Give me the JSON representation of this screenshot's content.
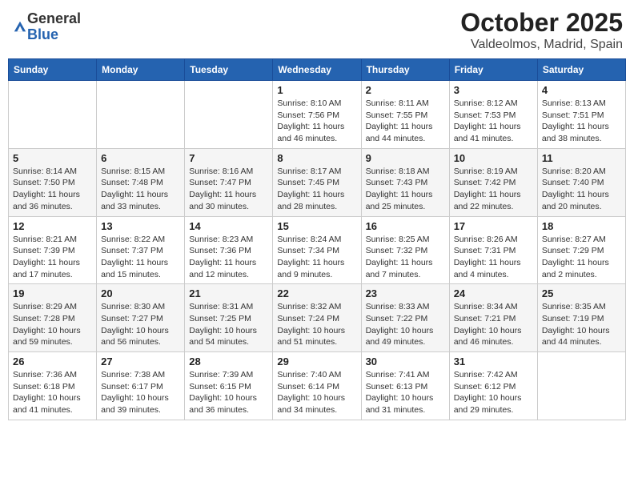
{
  "header": {
    "logo_general": "General",
    "logo_blue": "Blue",
    "title_month": "October 2025",
    "title_location": "Valdeolmos, Madrid, Spain"
  },
  "days_of_week": [
    "Sunday",
    "Monday",
    "Tuesday",
    "Wednesday",
    "Thursday",
    "Friday",
    "Saturday"
  ],
  "weeks": [
    [
      {
        "day": "",
        "sunrise": "",
        "sunset": "",
        "daylight": ""
      },
      {
        "day": "",
        "sunrise": "",
        "sunset": "",
        "daylight": ""
      },
      {
        "day": "",
        "sunrise": "",
        "sunset": "",
        "daylight": ""
      },
      {
        "day": "1",
        "sunrise": "Sunrise: 8:10 AM",
        "sunset": "Sunset: 7:56 PM",
        "daylight": "Daylight: 11 hours and 46 minutes."
      },
      {
        "day": "2",
        "sunrise": "Sunrise: 8:11 AM",
        "sunset": "Sunset: 7:55 PM",
        "daylight": "Daylight: 11 hours and 44 minutes."
      },
      {
        "day": "3",
        "sunrise": "Sunrise: 8:12 AM",
        "sunset": "Sunset: 7:53 PM",
        "daylight": "Daylight: 11 hours and 41 minutes."
      },
      {
        "day": "4",
        "sunrise": "Sunrise: 8:13 AM",
        "sunset": "Sunset: 7:51 PM",
        "daylight": "Daylight: 11 hours and 38 minutes."
      }
    ],
    [
      {
        "day": "5",
        "sunrise": "Sunrise: 8:14 AM",
        "sunset": "Sunset: 7:50 PM",
        "daylight": "Daylight: 11 hours and 36 minutes."
      },
      {
        "day": "6",
        "sunrise": "Sunrise: 8:15 AM",
        "sunset": "Sunset: 7:48 PM",
        "daylight": "Daylight: 11 hours and 33 minutes."
      },
      {
        "day": "7",
        "sunrise": "Sunrise: 8:16 AM",
        "sunset": "Sunset: 7:47 PM",
        "daylight": "Daylight: 11 hours and 30 minutes."
      },
      {
        "day": "8",
        "sunrise": "Sunrise: 8:17 AM",
        "sunset": "Sunset: 7:45 PM",
        "daylight": "Daylight: 11 hours and 28 minutes."
      },
      {
        "day": "9",
        "sunrise": "Sunrise: 8:18 AM",
        "sunset": "Sunset: 7:43 PM",
        "daylight": "Daylight: 11 hours and 25 minutes."
      },
      {
        "day": "10",
        "sunrise": "Sunrise: 8:19 AM",
        "sunset": "Sunset: 7:42 PM",
        "daylight": "Daylight: 11 hours and 22 minutes."
      },
      {
        "day": "11",
        "sunrise": "Sunrise: 8:20 AM",
        "sunset": "Sunset: 7:40 PM",
        "daylight": "Daylight: 11 hours and 20 minutes."
      }
    ],
    [
      {
        "day": "12",
        "sunrise": "Sunrise: 8:21 AM",
        "sunset": "Sunset: 7:39 PM",
        "daylight": "Daylight: 11 hours and 17 minutes."
      },
      {
        "day": "13",
        "sunrise": "Sunrise: 8:22 AM",
        "sunset": "Sunset: 7:37 PM",
        "daylight": "Daylight: 11 hours and 15 minutes."
      },
      {
        "day": "14",
        "sunrise": "Sunrise: 8:23 AM",
        "sunset": "Sunset: 7:36 PM",
        "daylight": "Daylight: 11 hours and 12 minutes."
      },
      {
        "day": "15",
        "sunrise": "Sunrise: 8:24 AM",
        "sunset": "Sunset: 7:34 PM",
        "daylight": "Daylight: 11 hours and 9 minutes."
      },
      {
        "day": "16",
        "sunrise": "Sunrise: 8:25 AM",
        "sunset": "Sunset: 7:32 PM",
        "daylight": "Daylight: 11 hours and 7 minutes."
      },
      {
        "day": "17",
        "sunrise": "Sunrise: 8:26 AM",
        "sunset": "Sunset: 7:31 PM",
        "daylight": "Daylight: 11 hours and 4 minutes."
      },
      {
        "day": "18",
        "sunrise": "Sunrise: 8:27 AM",
        "sunset": "Sunset: 7:29 PM",
        "daylight": "Daylight: 11 hours and 2 minutes."
      }
    ],
    [
      {
        "day": "19",
        "sunrise": "Sunrise: 8:29 AM",
        "sunset": "Sunset: 7:28 PM",
        "daylight": "Daylight: 10 hours and 59 minutes."
      },
      {
        "day": "20",
        "sunrise": "Sunrise: 8:30 AM",
        "sunset": "Sunset: 7:27 PM",
        "daylight": "Daylight: 10 hours and 56 minutes."
      },
      {
        "day": "21",
        "sunrise": "Sunrise: 8:31 AM",
        "sunset": "Sunset: 7:25 PM",
        "daylight": "Daylight: 10 hours and 54 minutes."
      },
      {
        "day": "22",
        "sunrise": "Sunrise: 8:32 AM",
        "sunset": "Sunset: 7:24 PM",
        "daylight": "Daylight: 10 hours and 51 minutes."
      },
      {
        "day": "23",
        "sunrise": "Sunrise: 8:33 AM",
        "sunset": "Sunset: 7:22 PM",
        "daylight": "Daylight: 10 hours and 49 minutes."
      },
      {
        "day": "24",
        "sunrise": "Sunrise: 8:34 AM",
        "sunset": "Sunset: 7:21 PM",
        "daylight": "Daylight: 10 hours and 46 minutes."
      },
      {
        "day": "25",
        "sunrise": "Sunrise: 8:35 AM",
        "sunset": "Sunset: 7:19 PM",
        "daylight": "Daylight: 10 hours and 44 minutes."
      }
    ],
    [
      {
        "day": "26",
        "sunrise": "Sunrise: 7:36 AM",
        "sunset": "Sunset: 6:18 PM",
        "daylight": "Daylight: 10 hours and 41 minutes."
      },
      {
        "day": "27",
        "sunrise": "Sunrise: 7:38 AM",
        "sunset": "Sunset: 6:17 PM",
        "daylight": "Daylight: 10 hours and 39 minutes."
      },
      {
        "day": "28",
        "sunrise": "Sunrise: 7:39 AM",
        "sunset": "Sunset: 6:15 PM",
        "daylight": "Daylight: 10 hours and 36 minutes."
      },
      {
        "day": "29",
        "sunrise": "Sunrise: 7:40 AM",
        "sunset": "Sunset: 6:14 PM",
        "daylight": "Daylight: 10 hours and 34 minutes."
      },
      {
        "day": "30",
        "sunrise": "Sunrise: 7:41 AM",
        "sunset": "Sunset: 6:13 PM",
        "daylight": "Daylight: 10 hours and 31 minutes."
      },
      {
        "day": "31",
        "sunrise": "Sunrise: 7:42 AM",
        "sunset": "Sunset: 6:12 PM",
        "daylight": "Daylight: 10 hours and 29 minutes."
      },
      {
        "day": "",
        "sunrise": "",
        "sunset": "",
        "daylight": ""
      }
    ]
  ]
}
